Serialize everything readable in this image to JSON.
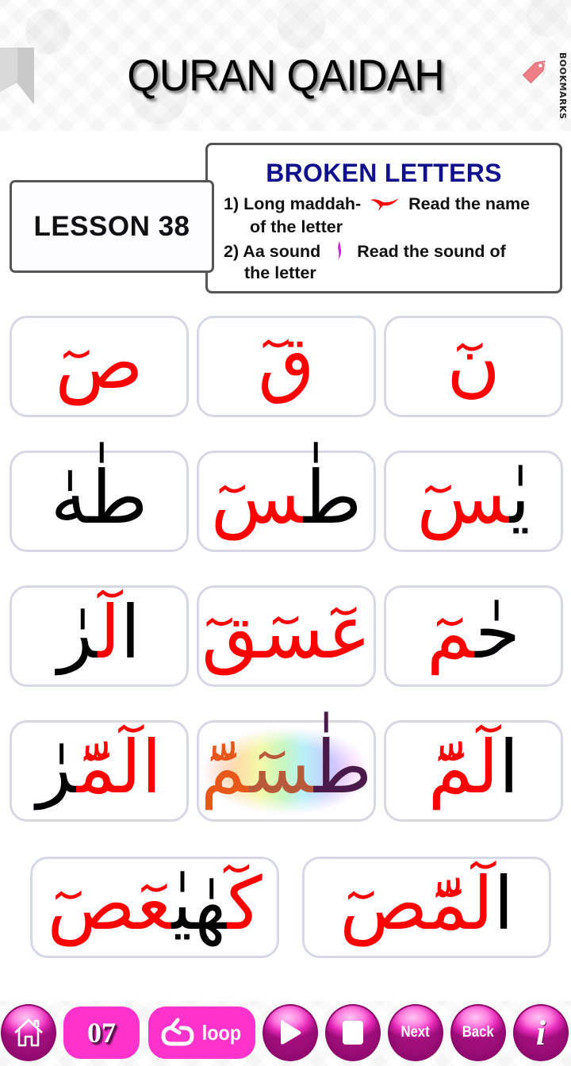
{
  "header": {
    "title": "QURAN QAIDAH",
    "bookmarks_label": "BOOKMARKS",
    "ribbon_icon": "bookmark-ribbon-icon",
    "tag_icon": "tag-icon"
  },
  "lesson": {
    "label": "LESSON 38"
  },
  "info": {
    "title": "BROKEN LETTERS",
    "rule1_prefix": "1) Long maddah-",
    "rule1_suffix": "Read the name",
    "rule1_cont": "of the letter",
    "rule1_symbol": "long-maddah-symbol",
    "rule2_prefix": "2) Aa sound",
    "rule2_suffix": "Read the sound of",
    "rule2_cont": "the letter",
    "rule2_symbol": "standing-fatha-symbol"
  },
  "colors": {
    "accent_red": "#ff0000",
    "aa_sound_purple": "#cc22dd",
    "title_blue": "#10108c",
    "button_pink": "#ff33cc",
    "card_border": "#d6d8e4"
  },
  "cards": [
    {
      "text": "صٓ",
      "parts": [
        {
          "t": "صٓ",
          "c": "red"
        }
      ]
    },
    {
      "text": "قٓ",
      "parts": [
        {
          "t": "قٓ",
          "c": "red"
        }
      ]
    },
    {
      "text": "نٓ",
      "parts": [
        {
          "t": "نٓ",
          "c": "red"
        }
      ]
    },
    {
      "text": "طٰهٰ",
      "parts": [
        {
          "t": "طٰهٰ",
          "c": "black"
        }
      ]
    },
    {
      "text": "طٰسٓ",
      "parts": [
        {
          "t": "طٰ",
          "c": "black"
        },
        {
          "t": "سٓ",
          "c": "red"
        }
      ]
    },
    {
      "text": "يٰسٓ",
      "parts": [
        {
          "t": "يٰ",
          "c": "black"
        },
        {
          "t": "سٓ",
          "c": "red"
        }
      ]
    },
    {
      "text": "الٓرٰ",
      "parts": [
        {
          "t": "ا",
          "c": "black"
        },
        {
          "t": "لٓ",
          "c": "red"
        },
        {
          "t": "رٰ",
          "c": "black"
        }
      ]
    },
    {
      "text": "عٓسٓقٓ",
      "parts": [
        {
          "t": "عٓسٓقٓ",
          "c": "red"
        }
      ]
    },
    {
      "text": "حٰمٓ",
      "parts": [
        {
          "t": "حٰ",
          "c": "black"
        },
        {
          "t": "مٓ",
          "c": "red"
        }
      ]
    },
    {
      "text": "الٓمّٓرٰ",
      "parts": [
        {
          "t": "ا",
          "c": "red"
        },
        {
          "t": "لٓمّٓ",
          "c": "red"
        },
        {
          "t": "رٰ",
          "c": "black"
        }
      ]
    },
    {
      "text": "طٰسٓمّٓ",
      "highlighted": true,
      "parts": [
        {
          "t": "طٰ",
          "c": "mix3"
        },
        {
          "t": "سٓ",
          "c": "mix2"
        },
        {
          "t": "مّٓ",
          "c": "mix1"
        }
      ]
    },
    {
      "text": "الٓمّٓ",
      "parts": [
        {
          "t": "ا",
          "c": "black"
        },
        {
          "t": "لٓمّٓ",
          "c": "red"
        }
      ]
    },
    {
      "text": "كٓهٰيٰعٓصٓ",
      "parts": [
        {
          "t": "كٓ",
          "c": "red"
        },
        {
          "t": "هٰيٰ",
          "c": "black"
        },
        {
          "t": "عٓصٓ",
          "c": "red"
        }
      ]
    },
    {
      "text": "الٓمّٓصٓ",
      "parts": [
        {
          "t": "ا",
          "c": "black"
        },
        {
          "t": "لٓمّٓصٓ",
          "c": "red"
        }
      ]
    }
  ],
  "toolbar": {
    "home_icon": "home-icon",
    "page_number": "07",
    "loop_label": "loop",
    "loop_icon": "loop-icon",
    "play_icon": "play-icon",
    "stop_icon": "stop-icon",
    "next_label": "Next",
    "back_label": "Back",
    "info_label": "i"
  }
}
